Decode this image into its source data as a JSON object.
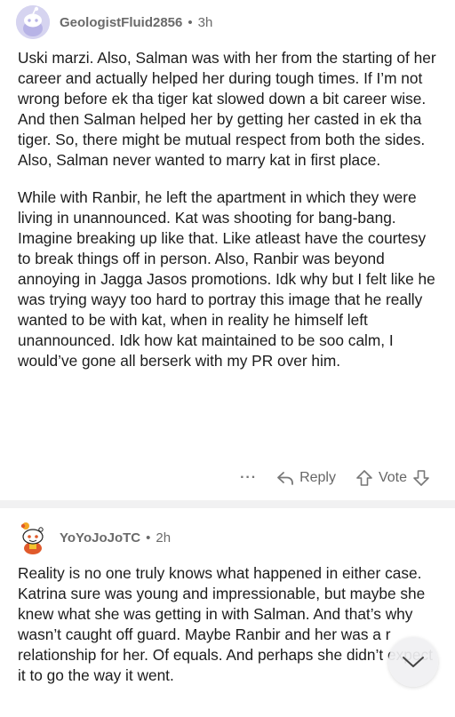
{
  "comments": [
    {
      "username": "GeologistFluid2856",
      "time": "3h",
      "paragraphs": [
        "Uski marzi. Also, Salman was with her from the starting of her career and actually helped her during tough times. If I’m not wrong before ek tha tiger kat slowed down a bit career wise. And then Salman helped her by getting her casted in ek tha tiger. So, there might be mutual respect from both the sides. Also, Salman never wanted to marry kat in first place.",
        "While with Ranbir, he left the apartment in which they were living in unannounced. Kat was shooting for bang-bang. Imagine breaking up like that. Like atleast have the courtesy to break things off in person. Also, Ranbir was beyond annoying in Jagga Jasos promotions. Idk why but I felt like he was trying wayy too hard to portray this image that he really wanted to be with kat, when in reality he himself left unannounced. Idk how kat maintained to be soo calm, I would’ve gone all berserk with my PR over him."
      ],
      "actions": {
        "more": "···",
        "reply": "Reply",
        "vote": "Vote"
      }
    },
    {
      "username": "YoYoJoJoTC",
      "time": "2h",
      "paragraphs": [
        "Reality is no one truly knows what happened in either case. Katrina sure was young and impressionable, but maybe she knew what she was getting in with Salman. And that’s why wasn’t caught off guard. Maybe Ranbir and her was a r relationship for her. Of equals. And perhaps she didn’t expect it to go the way it went."
      ]
    }
  ],
  "meta_separator": "•",
  "icons": {
    "avatar1": "snoo-avatar-icon",
    "avatar2": "snoo-avatar-icon",
    "reply": "reply-arrow-icon",
    "upvote": "upvote-arrow-icon",
    "downvote": "downvote-arrow-icon",
    "scroll": "chevron-down-icon"
  }
}
